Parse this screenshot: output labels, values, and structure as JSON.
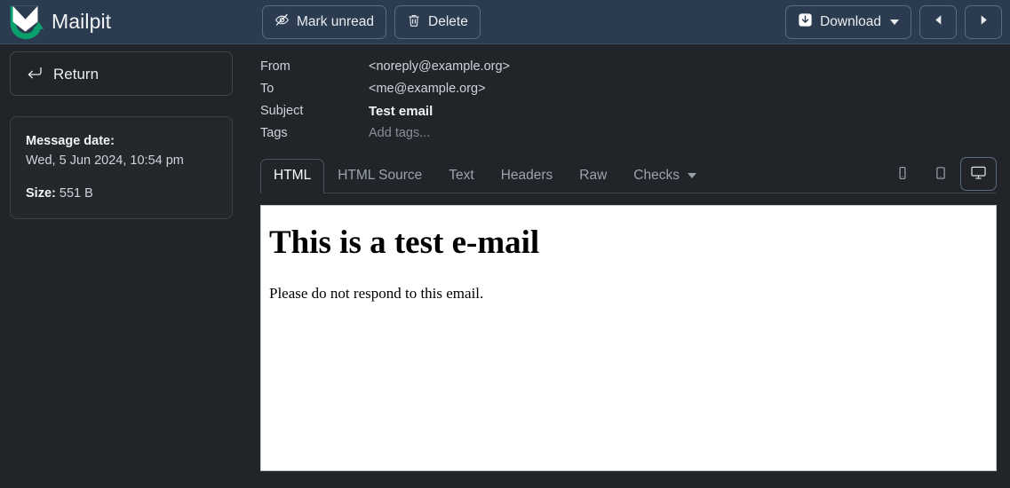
{
  "app": {
    "name": "Mailpit",
    "logo_icon": "mailpit-envelope-logo"
  },
  "toolbar": {
    "mark_unread_label": "Mark unread",
    "mark_unread_icon": "eye-slash-icon",
    "delete_label": "Delete",
    "delete_icon": "trash-icon",
    "download_label": "Download",
    "download_icon": "download-icon",
    "prev_icon": "triangle-left-icon",
    "next_icon": "triangle-right-icon"
  },
  "sidebar": {
    "return_label": "Return",
    "return_icon": "return-arrow-icon",
    "message_date_label": "Message date:",
    "message_date_value": "Wed, 5 Jun 2024, 10:54 pm",
    "size_label": "Size:",
    "size_value": "551 B"
  },
  "message": {
    "from_label": "From",
    "from_value": "<noreply@example.org>",
    "to_label": "To",
    "to_value": "<me@example.org>",
    "subject_label": "Subject",
    "subject_value": "Test email",
    "tags_label": "Tags",
    "tags_placeholder": "Add tags..."
  },
  "tabs": [
    {
      "label": "HTML",
      "active": true
    },
    {
      "label": "HTML Source",
      "active": false
    },
    {
      "label": "Text",
      "active": false
    },
    {
      "label": "Headers",
      "active": false
    },
    {
      "label": "Raw",
      "active": false
    },
    {
      "label": "Checks",
      "active": false,
      "has_caret": true
    }
  ],
  "viewport": {
    "phone_icon": "phone-icon",
    "tablet_icon": "tablet-icon",
    "desktop_icon": "desktop-monitor-icon",
    "active": "desktop"
  },
  "preview": {
    "heading": "This is a test e-mail",
    "body": "Please do not respond to this email."
  },
  "colors": {
    "navbar_bg": "#2c3c50",
    "page_bg": "#212529",
    "brand_green": "#0aa06e",
    "preview_bg": "#ffffff",
    "muted_text": "#868e96"
  }
}
